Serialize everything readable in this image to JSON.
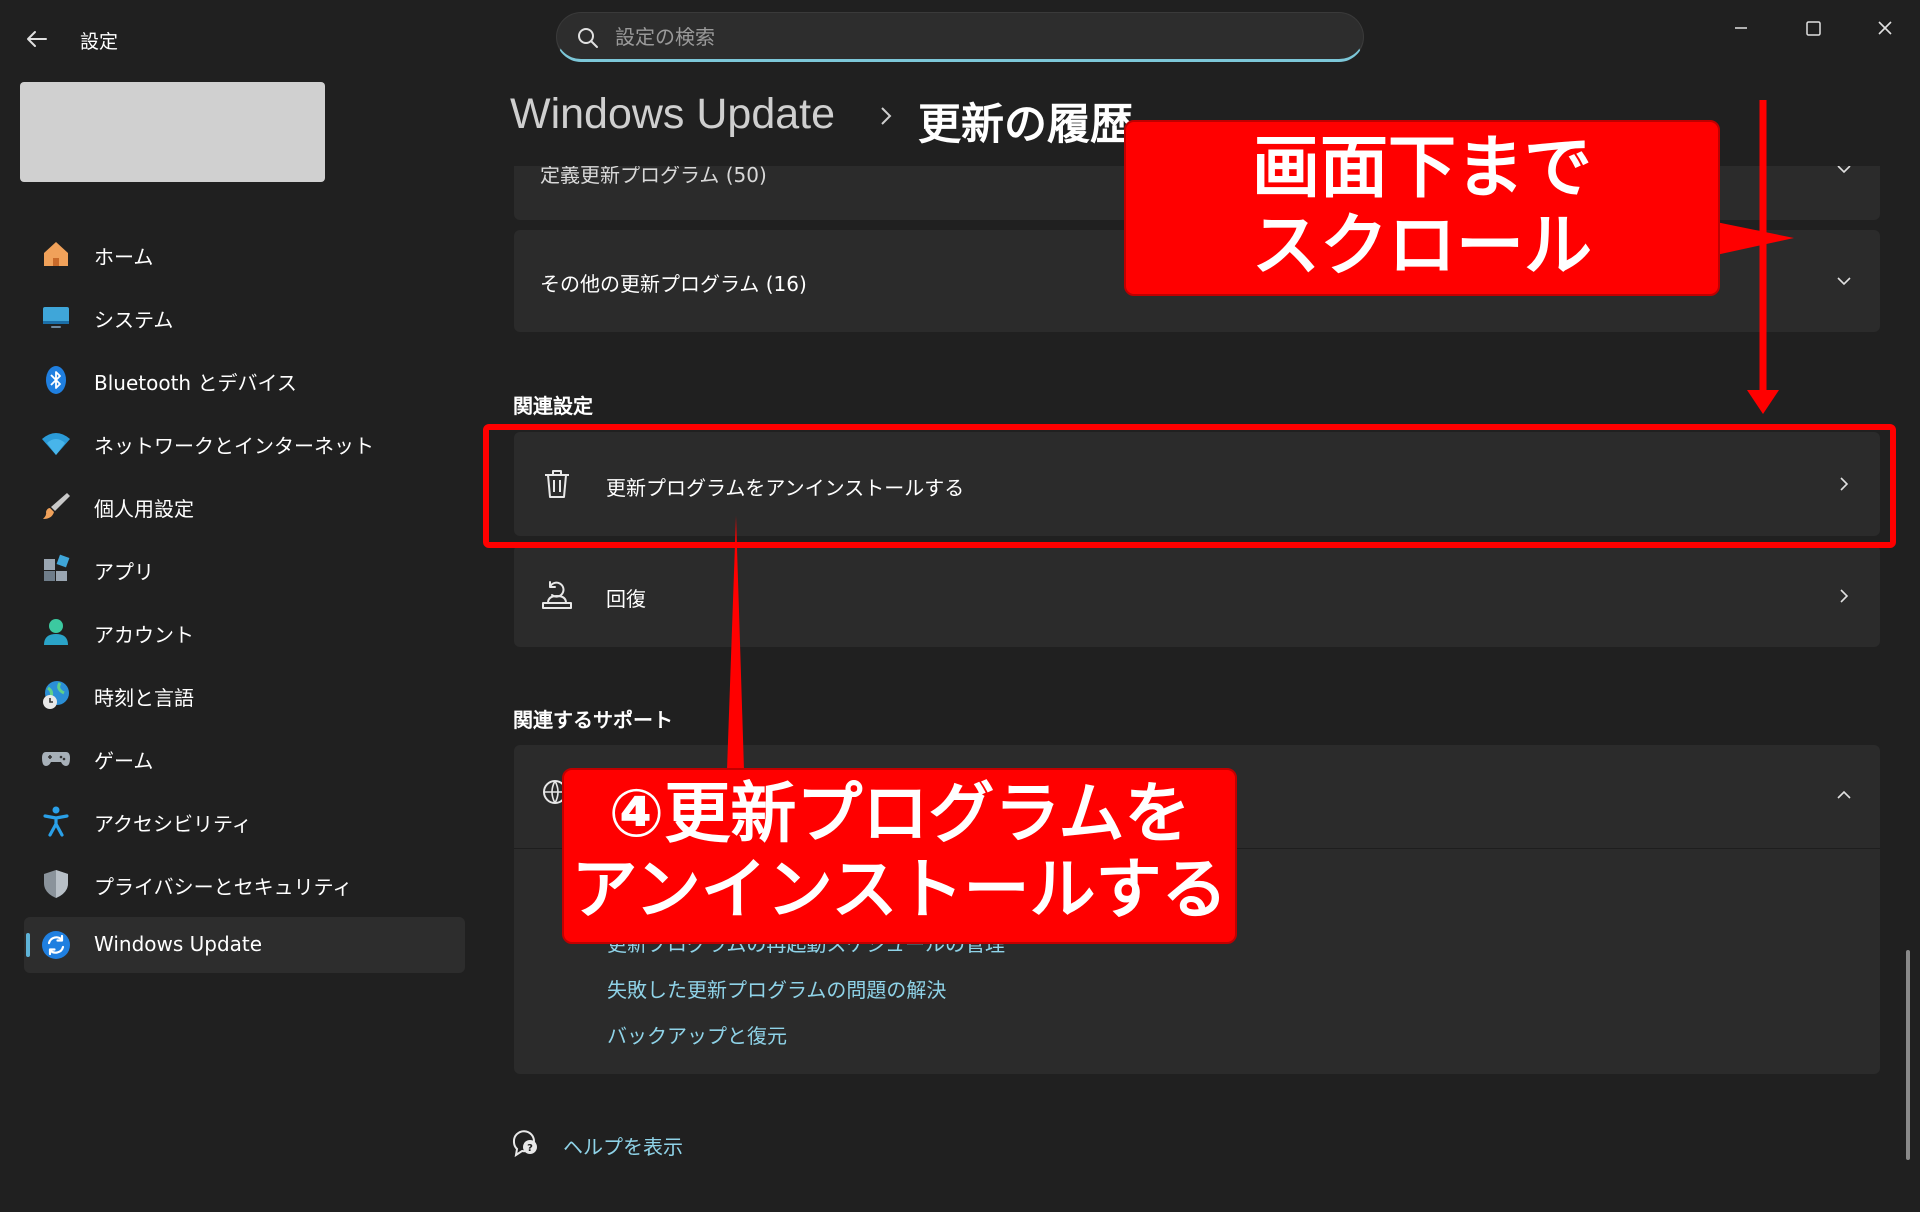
{
  "window": {
    "app_title": "設定",
    "search_placeholder": "設定の検索"
  },
  "sidebar": {
    "items": [
      {
        "label": "ホーム",
        "icon": "home-icon"
      },
      {
        "label": "システム",
        "icon": "system-icon"
      },
      {
        "label": "Bluetooth とデバイス",
        "icon": "bluetooth-icon"
      },
      {
        "label": "ネットワークとインターネット",
        "icon": "wifi-icon"
      },
      {
        "label": "個人用設定",
        "icon": "brush-icon"
      },
      {
        "label": "アプリ",
        "icon": "apps-icon"
      },
      {
        "label": "アカウント",
        "icon": "account-icon"
      },
      {
        "label": "時刻と言語",
        "icon": "time-language-icon"
      },
      {
        "label": "ゲーム",
        "icon": "gamepad-icon"
      },
      {
        "label": "アクセシビリティ",
        "icon": "accessibility-icon"
      },
      {
        "label": "プライバシーとセキュリティ",
        "icon": "shield-icon"
      },
      {
        "label": "Windows Update",
        "icon": "windows-update-icon",
        "selected": true
      }
    ]
  },
  "main": {
    "breadcrumb_parent": "Windows Update",
    "breadcrumb_current": "更新の履歴",
    "history_cards": [
      {
        "label": "定義更新プログラム (50)"
      },
      {
        "label": "その他の更新プログラム (16)"
      }
    ],
    "related_settings": {
      "heading": "関連設定",
      "items": [
        {
          "label": "更新プログラムをアンインストールする",
          "icon": "trash-icon"
        },
        {
          "label": "回復",
          "icon": "recovery-icon"
        }
      ]
    },
    "related_support": {
      "heading": "関連するサポート",
      "links": [
        "更新プログラムの再起動スケジュールの管理",
        "失敗した更新プログラムの問題の解決",
        "バックアップと復元"
      ]
    },
    "help_link": "ヘルプを表示"
  },
  "annotations": {
    "callout_scroll": [
      "画面下まで",
      "スクロール"
    ],
    "callout_uninstall": [
      "④更新プログラムを",
      "アンインストールする"
    ],
    "highlight_color": "#ff0000"
  },
  "colors": {
    "background": "#202020",
    "card": "#2b2b2b",
    "accent": "#5fb4d8",
    "link": "#8fd3e8"
  }
}
